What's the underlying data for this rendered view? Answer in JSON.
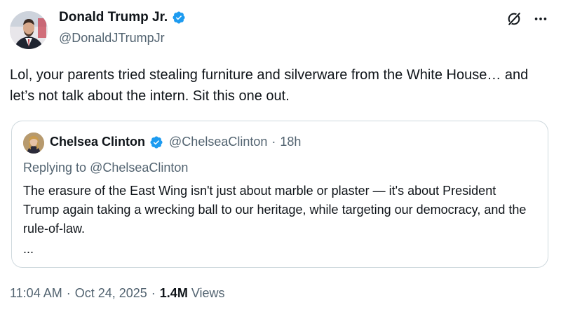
{
  "author": {
    "display_name": "Donald Trump Jr.",
    "handle": "@DonaldJTrumpJr",
    "verified_badge": "verified-badge-icon",
    "badge_color": "#1d9bf0"
  },
  "header_icons": [
    "grok-icon",
    "more-options-icon"
  ],
  "tweet_text": "Lol, your parents tried stealing furniture and silverware from the White House… and let’s not talk about the intern. Sit this one out.",
  "quote": {
    "display_name": "Chelsea Clinton",
    "handle": "@ChelseaClinton",
    "separator": "·",
    "time": "18h",
    "reply_prefix": "Replying to",
    "reply_mention": "@ChelseaClinton",
    "text": "The erasure of the East Wing isn't just about marble or plaster — it's about President Trump again taking a wrecking ball to our heritage, while targeting our democracy, and the rule-of-law.",
    "ellipsis": "..."
  },
  "meta": {
    "time": "11:04 AM",
    "sep1": "·",
    "date": "Oct 24, 2025",
    "sep2": "·",
    "views_count": "1.4M",
    "views_label": "Views"
  },
  "colors": {
    "text_primary": "#0f1419",
    "text_secondary": "#536471",
    "border": "#cfd9de",
    "verified": "#1d9bf0"
  }
}
